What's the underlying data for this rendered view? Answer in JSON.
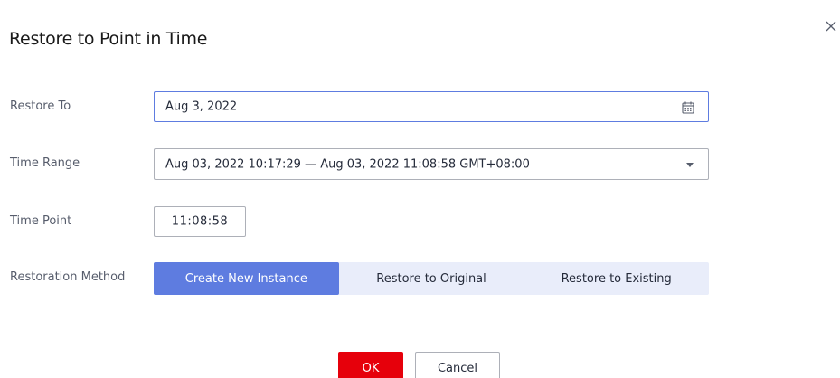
{
  "dialog": {
    "title": "Restore to Point in Time",
    "close_icon": "close-icon"
  },
  "form": {
    "restore_to": {
      "label": "Restore To",
      "value": "Aug 3, 2022",
      "icon": "calendar-icon"
    },
    "time_range": {
      "label": "Time Range",
      "value": "Aug 03, 2022 10:17:29 — Aug 03, 2022 11:08:58 GMT+08:00",
      "icon": "chevron-down-icon"
    },
    "time_point": {
      "label": "Time Point",
      "value": "11:08:58"
    },
    "restoration_method": {
      "label": "Restoration Method",
      "options": [
        {
          "label": "Create New Instance",
          "selected": true
        },
        {
          "label": "Restore to Original",
          "selected": false
        },
        {
          "label": "Restore to Existing",
          "selected": false
        }
      ]
    }
  },
  "footer": {
    "ok_label": "OK",
    "cancel_label": "Cancel"
  },
  "colors": {
    "primary": "#5e7ce0",
    "danger": "#e6000b",
    "segment_bg": "#e9edfa"
  }
}
